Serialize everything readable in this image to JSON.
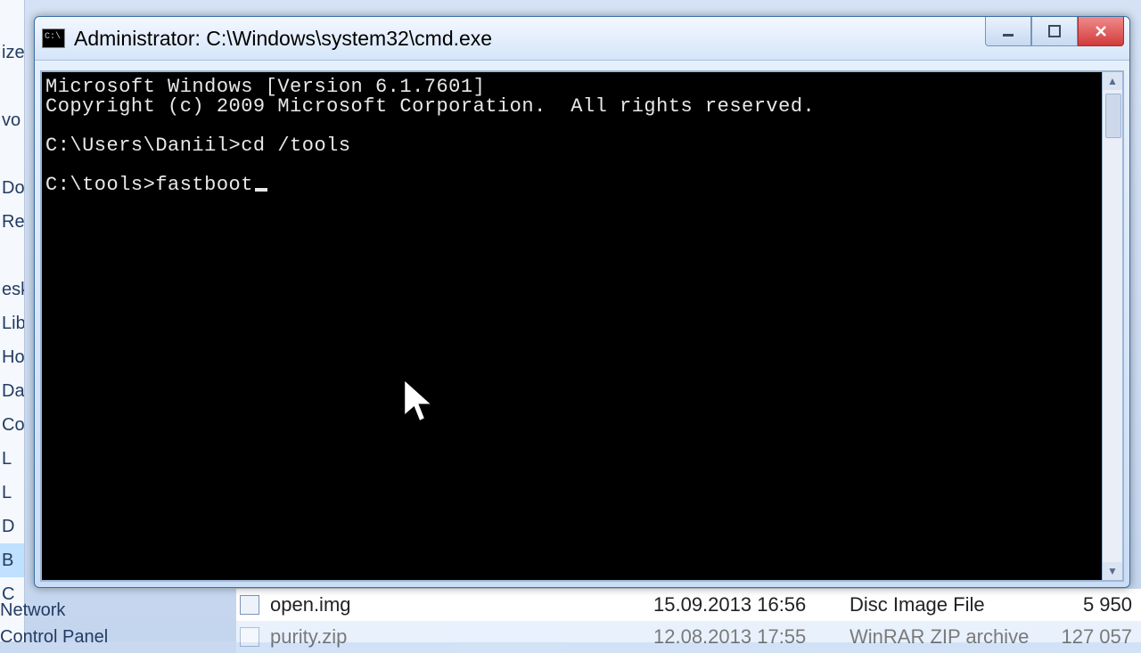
{
  "window": {
    "title": "Administrator: C:\\Windows\\system32\\cmd.exe"
  },
  "console": {
    "line1": "Microsoft Windows [Version 6.1.7601]",
    "line2": "Copyright (c) 2009 Microsoft Corporation.  All rights reserved.",
    "blank1": "",
    "prompt1": "C:\\Users\\Daniil>",
    "cmd1": "cd /tools",
    "blank2": "",
    "prompt2": "C:\\tools>",
    "cmd2": "fastboot"
  },
  "sidebar": {
    "items": [
      "ize",
      "",
      "vo",
      "",
      "Do",
      "Re",
      "",
      "esk",
      "Lib",
      "Ho",
      "Da",
      "Co",
      " L",
      " L",
      " D",
      " B",
      " C"
    ],
    "highlight_index": 15
  },
  "lowleft": {
    "a": "Network",
    "b": "Control Panel"
  },
  "files": {
    "row1": {
      "name": "open.img",
      "date": "15.09.2013 16:56",
      "type": "Disc Image File",
      "size": "5 950"
    },
    "row2": {
      "name": "purity.zip",
      "date": "12.08.2013 17:55",
      "type": "WinRAR ZIP archive",
      "size": "127 057"
    }
  }
}
